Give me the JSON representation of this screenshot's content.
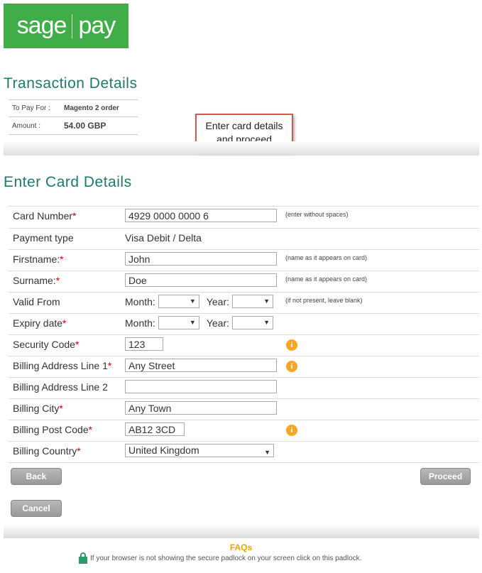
{
  "logo": {
    "left": "sage",
    "right": "pay"
  },
  "transaction": {
    "title": "Transaction Details",
    "to_pay_label": "To Pay For :",
    "to_pay_value": "Magento 2 order",
    "amount_label": "Amount :",
    "amount_value": "54.00 GBP"
  },
  "callout": {
    "line1": "Enter card details",
    "line2": "and proceed"
  },
  "card": {
    "title": "Enter Card Details",
    "card_number_label": "Card Number",
    "card_number_value": "4929 0000 0000 6",
    "card_number_hint": "(enter without spaces)",
    "payment_type_label": "Payment type",
    "payment_type_value": "Visa Debit / Delta",
    "firstname_label": "Firstname:",
    "firstname_value": "John",
    "name_hint": "(name as it appears on card)",
    "surname_label": "Surname:",
    "surname_value": "Doe",
    "valid_from_label": "Valid From",
    "valid_from_hint": "(if not present, leave blank)",
    "month_label": "Month:",
    "year_label": "Year:",
    "expiry_label": "Expiry date",
    "security_label": "Security Code",
    "security_value": "123",
    "addr1_label": "Billing Address Line 1",
    "addr1_value": "Any Street",
    "addr2_label": "Billing Address Line 2",
    "addr2_value": "",
    "city_label": "Billing City",
    "city_value": "Any Town",
    "postcode_label": "Billing Post Code",
    "postcode_value": "AB12 3CD",
    "country_label": "Billing Country",
    "country_value": "United Kingdom",
    "required_mark": "*",
    "info_glyph": "i"
  },
  "buttons": {
    "back": "Back",
    "proceed": "Proceed",
    "cancel": "Cancel"
  },
  "footer": {
    "faqs": "FAQs",
    "padlock_note": "If your browser is not showing the secure padlock on your screen click on this padlock."
  },
  "colors": {
    "brand_green": "#41ad49",
    "heading_teal": "#1d7a6c",
    "info_orange": "#f5a623",
    "callout_red": "#d9534f"
  }
}
